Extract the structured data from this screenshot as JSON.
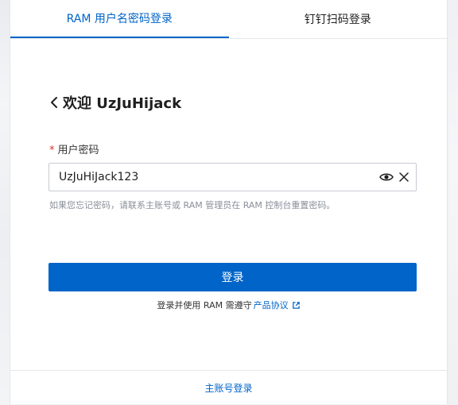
{
  "tabs": [
    {
      "label": "RAM 用户名密码登录",
      "active": true
    },
    {
      "label": "钉钉扫码登录",
      "active": false
    }
  ],
  "welcome": {
    "text": "欢迎 UzJuHijack"
  },
  "password_field": {
    "required_mark": "*",
    "label": "用户密码",
    "value": "UzJuHiJack123"
  },
  "hint": "如果您忘记密码，请联系主账号或 RAM 管理员在 RAM 控制台重置密码。",
  "login_button": "登录",
  "agreement": {
    "prefix": "登录并使用 RAM 需遵守",
    "link": "产品协议"
  },
  "footer": {
    "main_account_link": "主账号登录"
  },
  "colors": {
    "accent": "#0064c8",
    "required": "#d93026"
  },
  "icons": [
    "back-chevron-icon",
    "eye-icon",
    "clear-icon",
    "external-link-icon"
  ]
}
